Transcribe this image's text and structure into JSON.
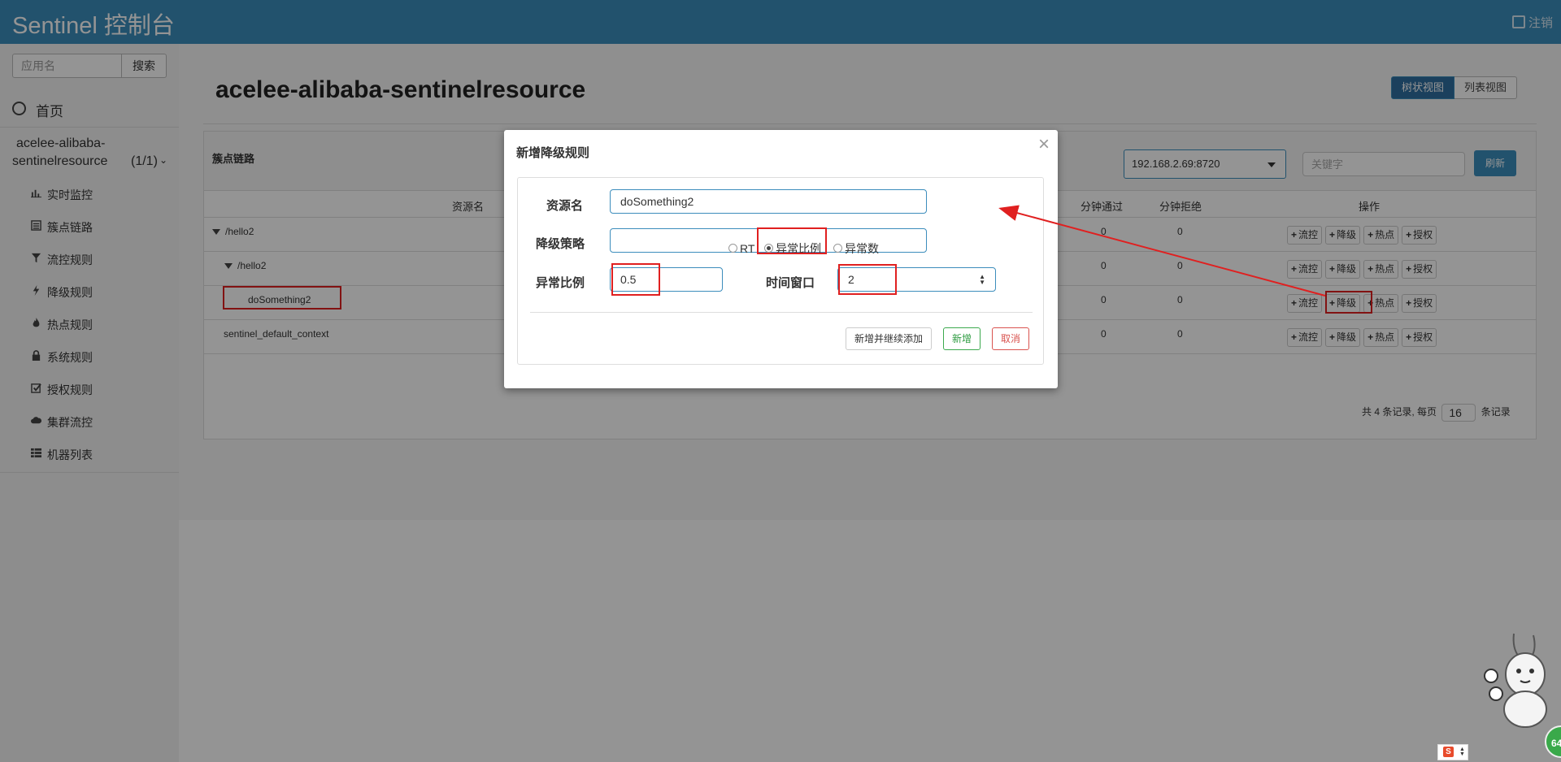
{
  "header": {
    "brand": "Sentinel 控制台",
    "logout": "注销"
  },
  "sidebar": {
    "search_placeholder": "应用名",
    "search_button": "搜索",
    "home_label": "首页",
    "app_name_line1": "acelee-alibaba-",
    "app_name_line2": "sentinelresource",
    "app_count": "(1/1)",
    "menu": [
      {
        "label": "实时监控",
        "icon": "bar-chart-icon"
      },
      {
        "label": "簇点链路",
        "icon": "list-icon"
      },
      {
        "label": "流控规则",
        "icon": "filter-icon"
      },
      {
        "label": "降级规则",
        "icon": "flash-icon"
      },
      {
        "label": "热点规则",
        "icon": "fire-icon"
      },
      {
        "label": "系统规则",
        "icon": "lock-icon"
      },
      {
        "label": "授权规则",
        "icon": "check-icon"
      },
      {
        "label": "集群流控",
        "icon": "cloud-icon"
      },
      {
        "label": "机器列表",
        "icon": "th-list-icon"
      }
    ]
  },
  "main": {
    "title": "acelee-alibaba-sentinelresource",
    "view_tree": "树状视图",
    "view_list": "列表视图",
    "panel_title": "簇点链路",
    "ip_select": "192.168.2.69:8720",
    "keyword_placeholder": "关键字",
    "refresh": "刷新",
    "columns": {
      "resource": "资源名",
      "pass_min": "分钟通过",
      "block_min": "分钟拒绝",
      "ops": "操作"
    },
    "rows": [
      {
        "name": "/hello2",
        "pass": "0",
        "block": "0"
      },
      {
        "name": "/hello2",
        "pass": "0",
        "block": "0"
      },
      {
        "name": "doSomething2",
        "pass": "0",
        "block": "0"
      },
      {
        "name": "sentinel_default_context",
        "pass": "0",
        "block": "0"
      }
    ],
    "op_labels": {
      "flow": "流控",
      "degrade": "降级",
      "hot": "热点",
      "auth": "授权"
    },
    "pager": {
      "prefix": "共 4 条记录, 每页",
      "page_size": "16",
      "suffix": "条记录"
    }
  },
  "modal": {
    "title": "新增降级规则",
    "close": "×",
    "resource_label": "资源名",
    "resource_value": "doSomething2",
    "strategy_label": "降级策略",
    "strategy_options": [
      "RT",
      "异常比例",
      "异常数"
    ],
    "strategy_selected": "异常比例",
    "ratio_label": "异常比例",
    "ratio_value": "0.5",
    "window_label": "时间窗口",
    "window_value": "2",
    "btn_add_continue": "新增并继续添加",
    "btn_add": "新增",
    "btn_cancel": "取消"
  },
  "deco": {
    "badge": "64",
    "mini_tool_letter": "S"
  },
  "colors": {
    "header": "#3c8dbc",
    "annotation": "#e02020",
    "success": "#3ca94e",
    "danger": "#d9534f"
  }
}
